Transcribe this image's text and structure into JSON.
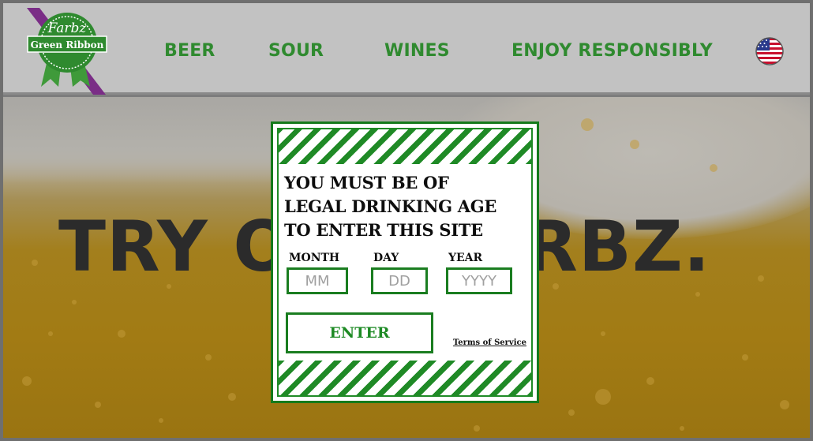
{
  "brand": {
    "logo_script": "Farbz",
    "logo_ribbon": "Green Ribbon",
    "colors": {
      "green": "#2f8a2f",
      "purple": "#7a2d86",
      "header_bg": "#c2c2c2"
    }
  },
  "nav": {
    "items": [
      {
        "label": "BEER"
      },
      {
        "label": "SOUR"
      },
      {
        "label": "WINES"
      },
      {
        "label": "ENJOY RESPONSIBLY"
      }
    ],
    "language_icon": "us-flag-icon"
  },
  "hero": {
    "title": "TRY OUR FARBZ."
  },
  "age_gate": {
    "heading_lines": [
      "YOU MUST BE OF",
      "LEGAL DRINKING AGE",
      "TO ENTER THIS SITE"
    ],
    "month": {
      "label": "MONTH",
      "placeholder": "MM",
      "value": ""
    },
    "day": {
      "label": "DAY",
      "placeholder": "DD",
      "value": ""
    },
    "year": {
      "label": "YEAR",
      "placeholder": "YYYY",
      "value": ""
    },
    "enter_label": "ENTER",
    "terms_label": "Terms of Service"
  }
}
